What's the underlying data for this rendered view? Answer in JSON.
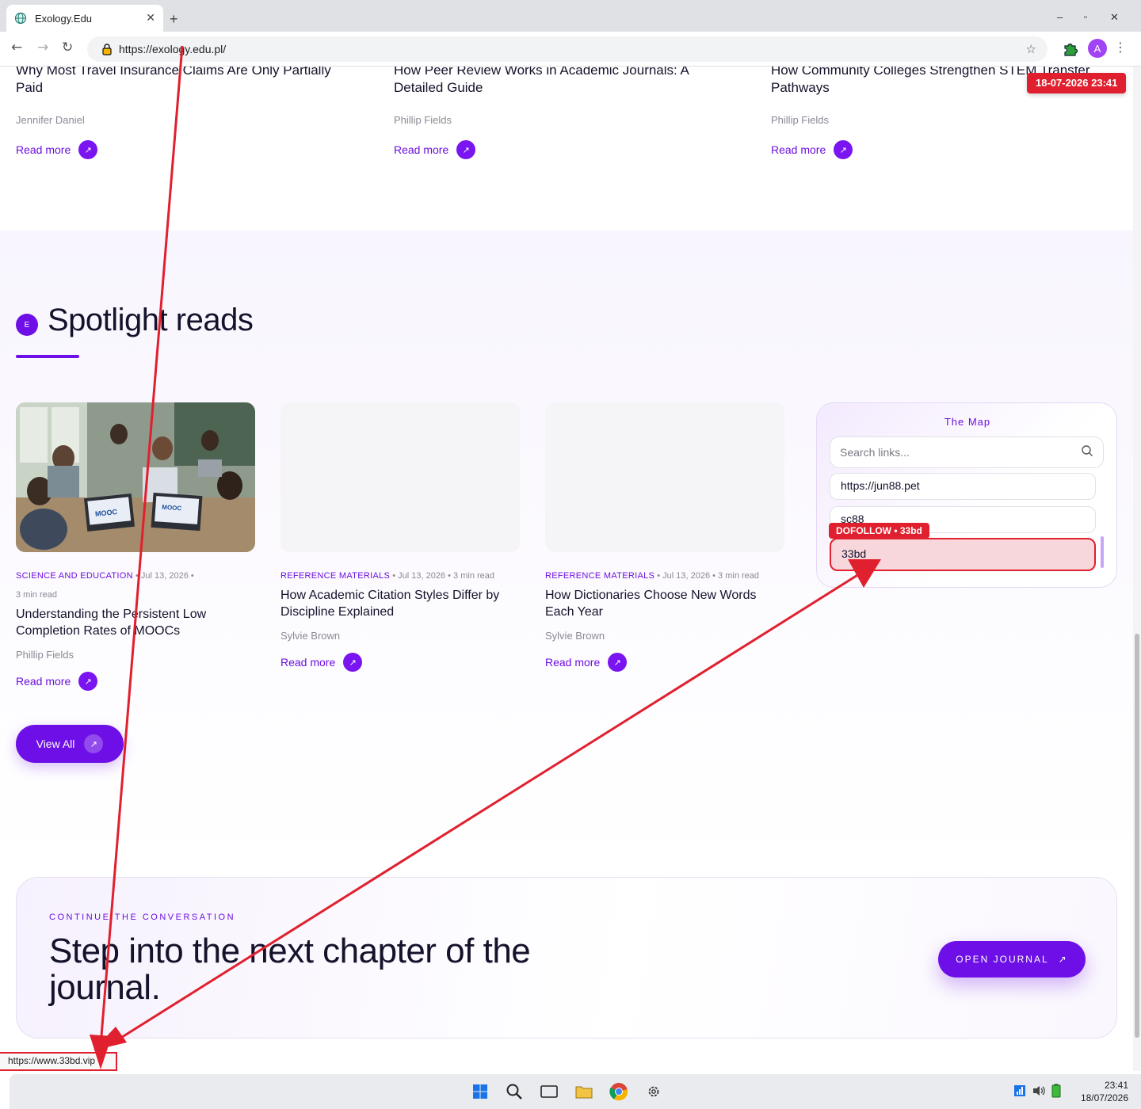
{
  "browser": {
    "tab_title": "Exology.Edu",
    "url": "https://exology.edu.pl/",
    "avatar_letter": "A",
    "status_url": "https://www.33bd.vip"
  },
  "top_articles": [
    {
      "title": "Why Most Travel Insurance Claims Are Only Partially Paid",
      "author": "Jennifer Daniel",
      "read_more": "Read more"
    },
    {
      "title": "How Peer Review Works in Academic Journals: A Detailed Guide",
      "author": "Phillip Fields",
      "read_more": "Read more"
    },
    {
      "title": "How Community Colleges Strengthen STEM Transfer Pathways",
      "author": "Phillip Fields",
      "read_more": "Read more"
    }
  ],
  "spotlight": {
    "badge": "E",
    "heading": "Spotlight reads",
    "view_all": "View All",
    "cards": [
      {
        "category": "SCIENCE AND EDUCATION",
        "date": "Jul 13, 2026",
        "read_time": "3 min read",
        "title": "Understanding the Persistent Low Completion Rates of MOOCs",
        "author": "Phillip Fields",
        "read_more": "Read more",
        "thumb_text": "MOOC"
      },
      {
        "category": "REFERENCE MATERIALS",
        "date": "Jul 13, 2026",
        "read_time": "3 min read",
        "title": "How Academic Citation Styles Differ by Discipline Explained",
        "author": "Sylvie Brown",
        "read_more": "Read more"
      },
      {
        "category": "REFERENCE MATERIALS",
        "date": "Jul 13, 2026",
        "read_time": "3 min read",
        "title": "How Dictionaries Choose New Words Each Year",
        "author": "Sylvie Brown",
        "read_more": "Read more"
      }
    ]
  },
  "map": {
    "title": "The Map",
    "search_placeholder": "Search links...",
    "links": [
      "https://jun88.pet",
      "sc88",
      "33bd"
    ],
    "tag": "DOFOLLOW • 33bd"
  },
  "cta": {
    "kicker": "CONTINUE THE CONVERSATION",
    "heading": "Step into the next chapter of the journal.",
    "button": "OPEN JOURNAL"
  },
  "annotation": {
    "timestamp": "18-07-2026 23:41"
  },
  "taskbar": {
    "time": "23:41",
    "date": "18/07/2026"
  },
  "colors": {
    "accent": "#6d0fe6",
    "annotation_red": "#e0202e"
  }
}
